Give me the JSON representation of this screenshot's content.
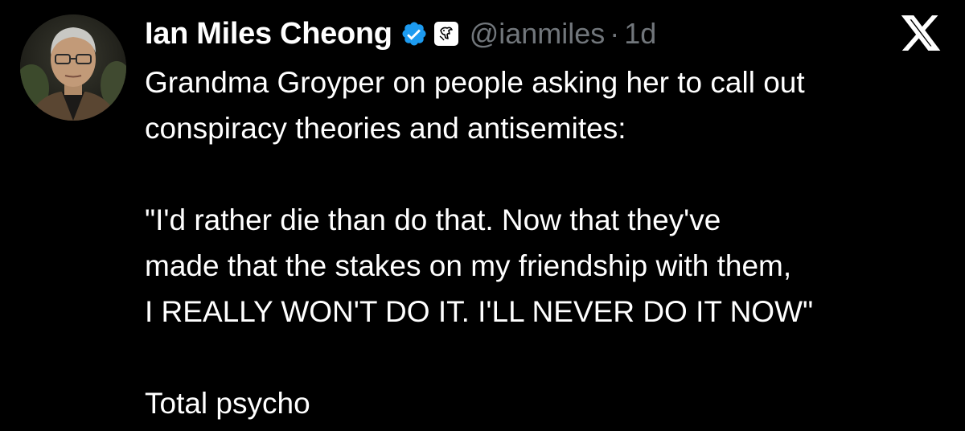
{
  "author": {
    "display_name": "Ian Miles Cheong",
    "handle": "@ianmiles",
    "separator": "·",
    "timestamp": "1d",
    "verified": true,
    "affiliate_badge": "ram-logo-badge"
  },
  "platform": {
    "logo": "x-logo-icon"
  },
  "tweet": {
    "lines": [
      "Grandma Groyper on people asking her to call out",
      "conspiracy theories and antisemites:",
      "",
      "\"I'd rather die than do that. Now that they've",
      "made that the stakes on my friendship with them,",
      "I REALLY WON'T DO IT. I'LL NEVER DO IT NOW\"",
      "",
      "Total psycho"
    ]
  },
  "colors": {
    "background": "#000000",
    "text_primary": "#ffffff",
    "text_secondary": "#71767b",
    "verified_blue": "#1d9bf0"
  }
}
